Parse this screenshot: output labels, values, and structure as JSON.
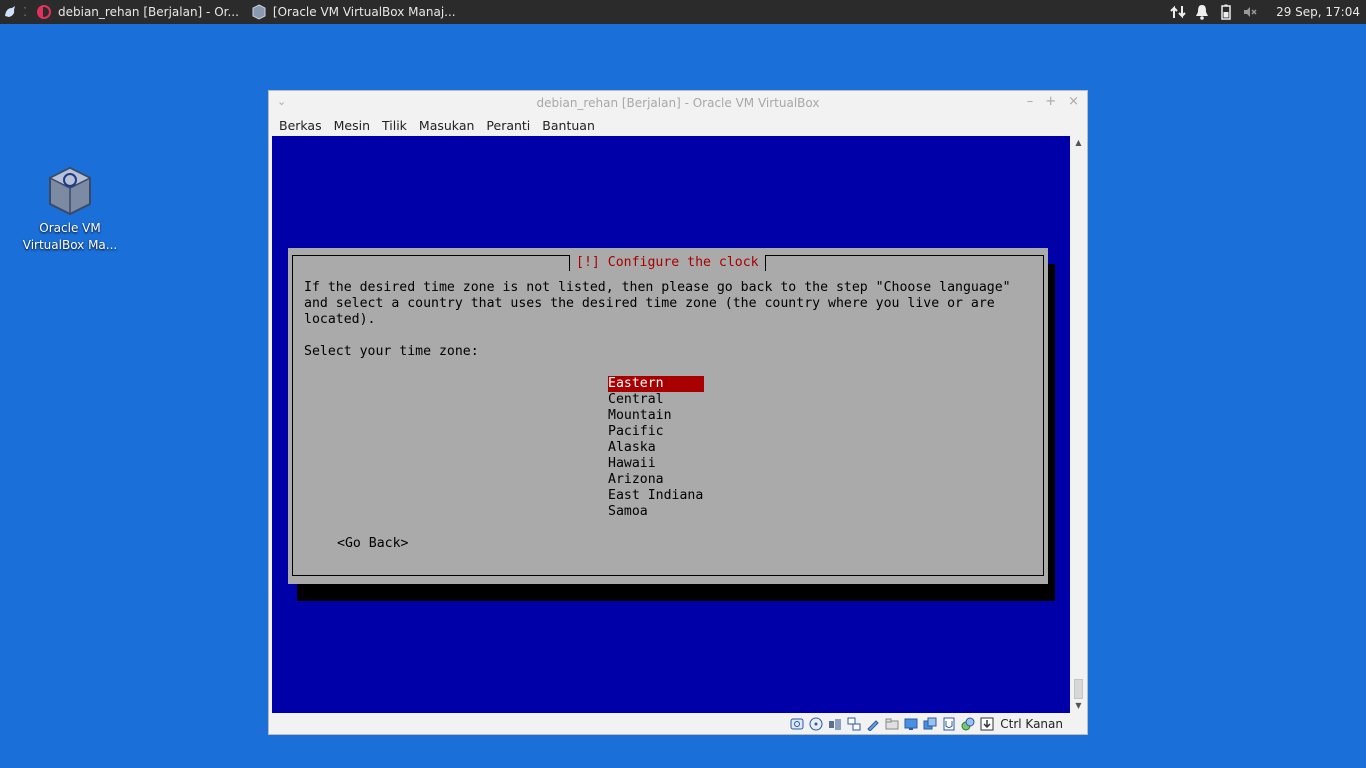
{
  "taskbar": {
    "tasks": [
      {
        "label": "debian_rehan [Berjalan] - Or...",
        "icon": "virtualbox-vm-icon"
      },
      {
        "label": "[Oracle VM VirtualBox Manaj...",
        "icon": "virtualbox-icon"
      }
    ],
    "clock": "29 Sep, 17:04"
  },
  "desktop": {
    "icon_label": "Oracle VM VirtualBox Ma..."
  },
  "window": {
    "title": "debian_rehan [Berjalan] - Oracle VM VirtualBox",
    "menu": [
      "Berkas",
      "Mesin",
      "Tilik",
      "Masukan",
      "Peranti",
      "Bantuan"
    ],
    "status_text": "Ctrl Kanan"
  },
  "installer": {
    "dialog_title": "[!] Configure the clock",
    "description": "If the desired time zone is not listed, then please go back to the step \"Choose language\"\nand select a country that uses the desired time zone (the country where you live or are\nlocated).",
    "prompt": "Select your time zone:",
    "timezones": [
      "Eastern",
      "Central",
      "Mountain",
      "Pacific",
      "Alaska",
      "Hawaii",
      "Arizona",
      "East Indiana",
      "Samoa"
    ],
    "selected": "Eastern",
    "go_back": "<Go Back>"
  },
  "colors": {
    "desktop_bg": "#1b6fd8",
    "vm_bg": "#0000a8",
    "dialog_bg": "#aaaaaa",
    "highlight": "#a80000"
  }
}
